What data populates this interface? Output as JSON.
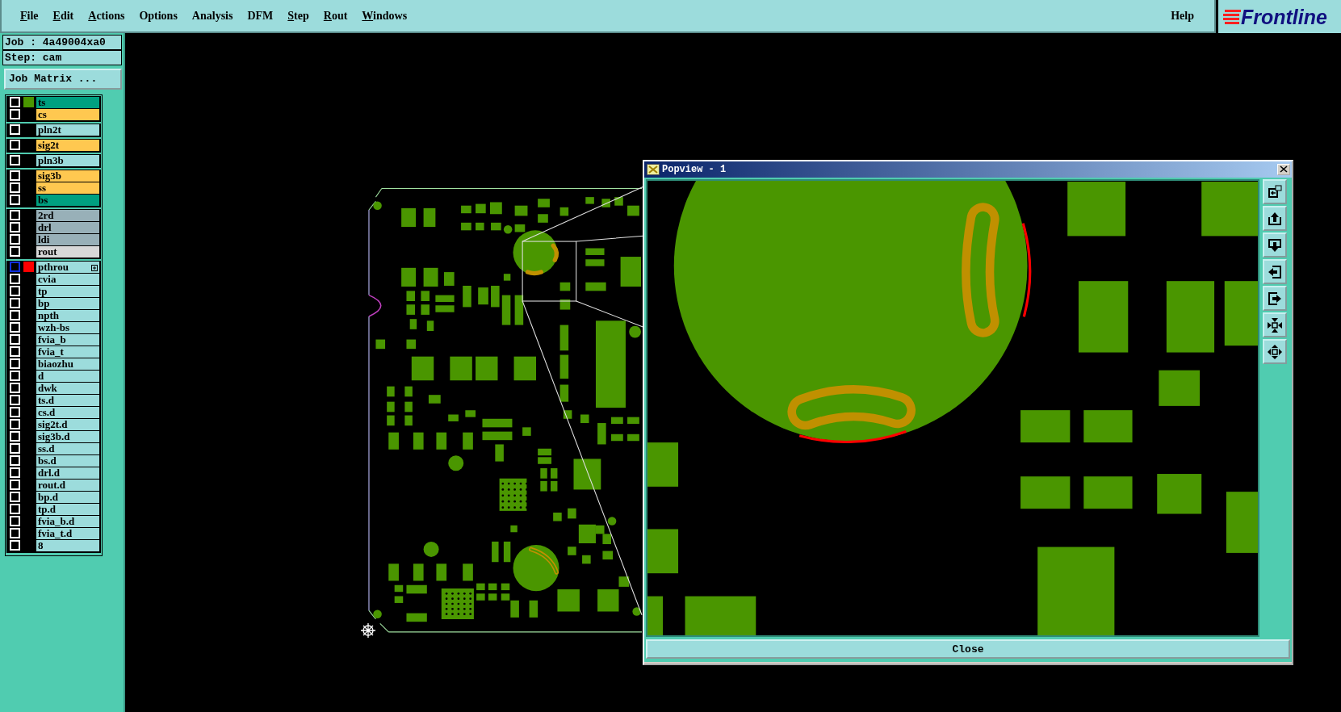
{
  "menu": [
    {
      "label": "File",
      "mnemonic": true
    },
    {
      "label": "Edit",
      "mnemonic": true
    },
    {
      "label": "Actions",
      "mnemonic": true
    },
    {
      "label": "Options",
      "mnemonic": false
    },
    {
      "label": "Analysis",
      "mnemonic": false
    },
    {
      "label": "DFM",
      "mnemonic": false
    },
    {
      "label": "Step",
      "mnemonic": true
    },
    {
      "label": "Rout",
      "mnemonic": true
    },
    {
      "label": "Windows",
      "mnemonic": true
    }
  ],
  "help": "Help",
  "logo": "Frontline",
  "job": "Job : 4a49004xa0",
  "step": "Step: cam",
  "job_matrix_button": "Job Matrix ...",
  "layer_groups": [
    [
      {
        "name": "ts",
        "kind": "mask",
        "displayed": true,
        "color": "#4a9600",
        "work": false
      },
      {
        "name": "cs",
        "kind": "signal",
        "displayed": false,
        "work": false
      }
    ],
    [
      {
        "name": "pln2t",
        "kind": "plane",
        "displayed": false,
        "work": false
      }
    ],
    [
      {
        "name": "sig2t",
        "kind": "signal",
        "displayed": false,
        "work": false
      }
    ],
    [
      {
        "name": "pln3b",
        "kind": "plane",
        "displayed": false,
        "work": false
      }
    ],
    [
      {
        "name": "sig3b",
        "kind": "signal",
        "displayed": false,
        "work": false
      },
      {
        "name": "ss",
        "kind": "signal",
        "displayed": false,
        "work": false
      },
      {
        "name": "bs",
        "kind": "mask",
        "displayed": false,
        "work": false
      }
    ],
    [
      {
        "name": "2rd",
        "kind": "drill",
        "displayed": false,
        "work": false
      },
      {
        "name": "drl",
        "kind": "drill",
        "displayed": false,
        "work": false
      },
      {
        "name": "ldi",
        "kind": "drill",
        "displayed": false,
        "work": false
      },
      {
        "name": "rout",
        "kind": "rout",
        "displayed": false,
        "work": false
      }
    ],
    [
      {
        "name": "pthrou",
        "kind": "misc",
        "displayed": true,
        "color": "#ff0000",
        "work": true
      },
      {
        "name": "cvia",
        "kind": "misc",
        "displayed": false,
        "work": false
      },
      {
        "name": "tp",
        "kind": "misc",
        "displayed": false,
        "work": false
      },
      {
        "name": "bp",
        "kind": "misc",
        "displayed": false,
        "work": false
      },
      {
        "name": "npth",
        "kind": "misc",
        "displayed": false,
        "work": false
      },
      {
        "name": "wzh-bs",
        "kind": "misc",
        "displayed": false,
        "work": false
      },
      {
        "name": "fvia_b",
        "kind": "misc",
        "displayed": false,
        "work": false
      },
      {
        "name": "fvia_t",
        "kind": "misc",
        "displayed": false,
        "work": false
      },
      {
        "name": "biaozhu",
        "kind": "misc",
        "displayed": false,
        "work": false
      },
      {
        "name": "d",
        "kind": "misc",
        "displayed": false,
        "work": false
      },
      {
        "name": "dwk",
        "kind": "misc",
        "displayed": false,
        "work": false
      },
      {
        "name": "ts.d",
        "kind": "misc",
        "displayed": false,
        "work": false
      },
      {
        "name": "cs.d",
        "kind": "misc",
        "displayed": false,
        "work": false
      },
      {
        "name": "sig2t.d",
        "kind": "misc",
        "displayed": false,
        "work": false
      },
      {
        "name": "sig3b.d",
        "kind": "misc",
        "displayed": false,
        "work": false
      },
      {
        "name": "ss.d",
        "kind": "misc",
        "displayed": false,
        "work": false
      },
      {
        "name": "bs.d",
        "kind": "misc",
        "displayed": false,
        "work": false
      },
      {
        "name": "drl.d",
        "kind": "misc",
        "displayed": false,
        "work": false
      },
      {
        "name": "rout.d",
        "kind": "misc",
        "displayed": false,
        "work": false
      },
      {
        "name": "bp.d",
        "kind": "misc",
        "displayed": false,
        "work": false
      },
      {
        "name": "tp.d",
        "kind": "misc",
        "displayed": false,
        "work": false
      },
      {
        "name": "fvia_b.d",
        "kind": "misc",
        "displayed": false,
        "work": false
      },
      {
        "name": "fvia_t.d",
        "kind": "misc",
        "displayed": false,
        "work": false
      },
      {
        "name": "8",
        "kind": "misc",
        "displayed": false,
        "work": false
      }
    ]
  ],
  "popview": {
    "title": "Popview - 1",
    "close_button": "Close"
  }
}
